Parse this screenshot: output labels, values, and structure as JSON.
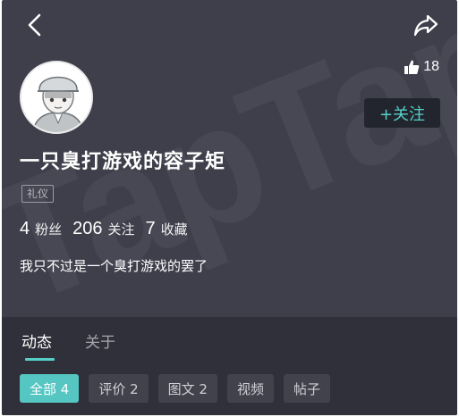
{
  "header": {
    "back_icon": "chevron-left-icon",
    "share_icon": "share-arrow-icon"
  },
  "profile": {
    "username": "一只臭打游戏的容子矩",
    "tag": "礼仪",
    "likes": "18",
    "follow_label": "+关注",
    "stats": [
      {
        "value": "4",
        "label": "粉丝"
      },
      {
        "value": "206",
        "label": "关注"
      },
      {
        "value": "7",
        "label": "收藏"
      }
    ],
    "bio": "我只不过是一个臭打游戏的罢了",
    "watermark": "TapTap"
  },
  "tabs": {
    "dynamic": "动态",
    "about": "关于"
  },
  "filters": [
    {
      "label": "全部 4",
      "active": true
    },
    {
      "label": "评价 2",
      "active": false
    },
    {
      "label": "图文 2",
      "active": false
    },
    {
      "label": "视频",
      "active": false
    },
    {
      "label": "帖子",
      "active": false
    }
  ],
  "colors": {
    "background": "#3e3f4b",
    "accent": "#56d0c8",
    "bottom_panel": "#2f3039"
  }
}
